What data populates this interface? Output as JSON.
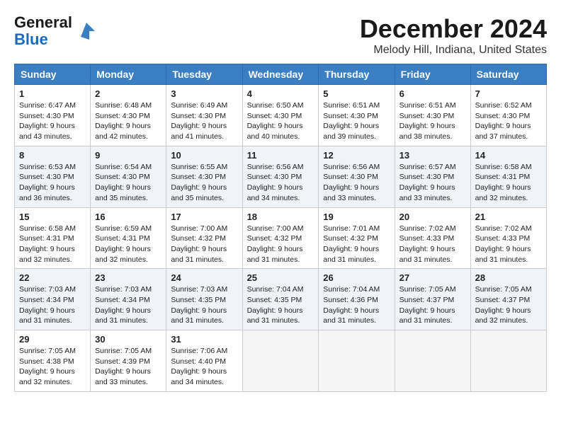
{
  "header": {
    "logo_general": "General",
    "logo_blue": "Blue",
    "month_title": "December 2024",
    "location": "Melody Hill, Indiana, United States"
  },
  "weekdays": [
    "Sunday",
    "Monday",
    "Tuesday",
    "Wednesday",
    "Thursday",
    "Friday",
    "Saturday"
  ],
  "weeks": [
    [
      {
        "day": "1",
        "sunrise": "6:47 AM",
        "sunset": "4:30 PM",
        "daylight": "9 hours and 43 minutes."
      },
      {
        "day": "2",
        "sunrise": "6:48 AM",
        "sunset": "4:30 PM",
        "daylight": "9 hours and 42 minutes."
      },
      {
        "day": "3",
        "sunrise": "6:49 AM",
        "sunset": "4:30 PM",
        "daylight": "9 hours and 41 minutes."
      },
      {
        "day": "4",
        "sunrise": "6:50 AM",
        "sunset": "4:30 PM",
        "daylight": "9 hours and 40 minutes."
      },
      {
        "day": "5",
        "sunrise": "6:51 AM",
        "sunset": "4:30 PM",
        "daylight": "9 hours and 39 minutes."
      },
      {
        "day": "6",
        "sunrise": "6:51 AM",
        "sunset": "4:30 PM",
        "daylight": "9 hours and 38 minutes."
      },
      {
        "day": "7",
        "sunrise": "6:52 AM",
        "sunset": "4:30 PM",
        "daylight": "9 hours and 37 minutes."
      }
    ],
    [
      {
        "day": "8",
        "sunrise": "6:53 AM",
        "sunset": "4:30 PM",
        "daylight": "9 hours and 36 minutes."
      },
      {
        "day": "9",
        "sunrise": "6:54 AM",
        "sunset": "4:30 PM",
        "daylight": "9 hours and 35 minutes."
      },
      {
        "day": "10",
        "sunrise": "6:55 AM",
        "sunset": "4:30 PM",
        "daylight": "9 hours and 35 minutes."
      },
      {
        "day": "11",
        "sunrise": "6:56 AM",
        "sunset": "4:30 PM",
        "daylight": "9 hours and 34 minutes."
      },
      {
        "day": "12",
        "sunrise": "6:56 AM",
        "sunset": "4:30 PM",
        "daylight": "9 hours and 33 minutes."
      },
      {
        "day": "13",
        "sunrise": "6:57 AM",
        "sunset": "4:30 PM",
        "daylight": "9 hours and 33 minutes."
      },
      {
        "day": "14",
        "sunrise": "6:58 AM",
        "sunset": "4:31 PM",
        "daylight": "9 hours and 32 minutes."
      }
    ],
    [
      {
        "day": "15",
        "sunrise": "6:58 AM",
        "sunset": "4:31 PM",
        "daylight": "9 hours and 32 minutes."
      },
      {
        "day": "16",
        "sunrise": "6:59 AM",
        "sunset": "4:31 PM",
        "daylight": "9 hours and 32 minutes."
      },
      {
        "day": "17",
        "sunrise": "7:00 AM",
        "sunset": "4:32 PM",
        "daylight": "9 hours and 31 minutes."
      },
      {
        "day": "18",
        "sunrise": "7:00 AM",
        "sunset": "4:32 PM",
        "daylight": "9 hours and 31 minutes."
      },
      {
        "day": "19",
        "sunrise": "7:01 AM",
        "sunset": "4:32 PM",
        "daylight": "9 hours and 31 minutes."
      },
      {
        "day": "20",
        "sunrise": "7:02 AM",
        "sunset": "4:33 PM",
        "daylight": "9 hours and 31 minutes."
      },
      {
        "day": "21",
        "sunrise": "7:02 AM",
        "sunset": "4:33 PM",
        "daylight": "9 hours and 31 minutes."
      }
    ],
    [
      {
        "day": "22",
        "sunrise": "7:03 AM",
        "sunset": "4:34 PM",
        "daylight": "9 hours and 31 minutes."
      },
      {
        "day": "23",
        "sunrise": "7:03 AM",
        "sunset": "4:34 PM",
        "daylight": "9 hours and 31 minutes."
      },
      {
        "day": "24",
        "sunrise": "7:03 AM",
        "sunset": "4:35 PM",
        "daylight": "9 hours and 31 minutes."
      },
      {
        "day": "25",
        "sunrise": "7:04 AM",
        "sunset": "4:35 PM",
        "daylight": "9 hours and 31 minutes."
      },
      {
        "day": "26",
        "sunrise": "7:04 AM",
        "sunset": "4:36 PM",
        "daylight": "9 hours and 31 minutes."
      },
      {
        "day": "27",
        "sunrise": "7:05 AM",
        "sunset": "4:37 PM",
        "daylight": "9 hours and 31 minutes."
      },
      {
        "day": "28",
        "sunrise": "7:05 AM",
        "sunset": "4:37 PM",
        "daylight": "9 hours and 32 minutes."
      }
    ],
    [
      {
        "day": "29",
        "sunrise": "7:05 AM",
        "sunset": "4:38 PM",
        "daylight": "9 hours and 32 minutes."
      },
      {
        "day": "30",
        "sunrise": "7:05 AM",
        "sunset": "4:39 PM",
        "daylight": "9 hours and 33 minutes."
      },
      {
        "day": "31",
        "sunrise": "7:06 AM",
        "sunset": "4:40 PM",
        "daylight": "9 hours and 34 minutes."
      },
      null,
      null,
      null,
      null
    ]
  ]
}
